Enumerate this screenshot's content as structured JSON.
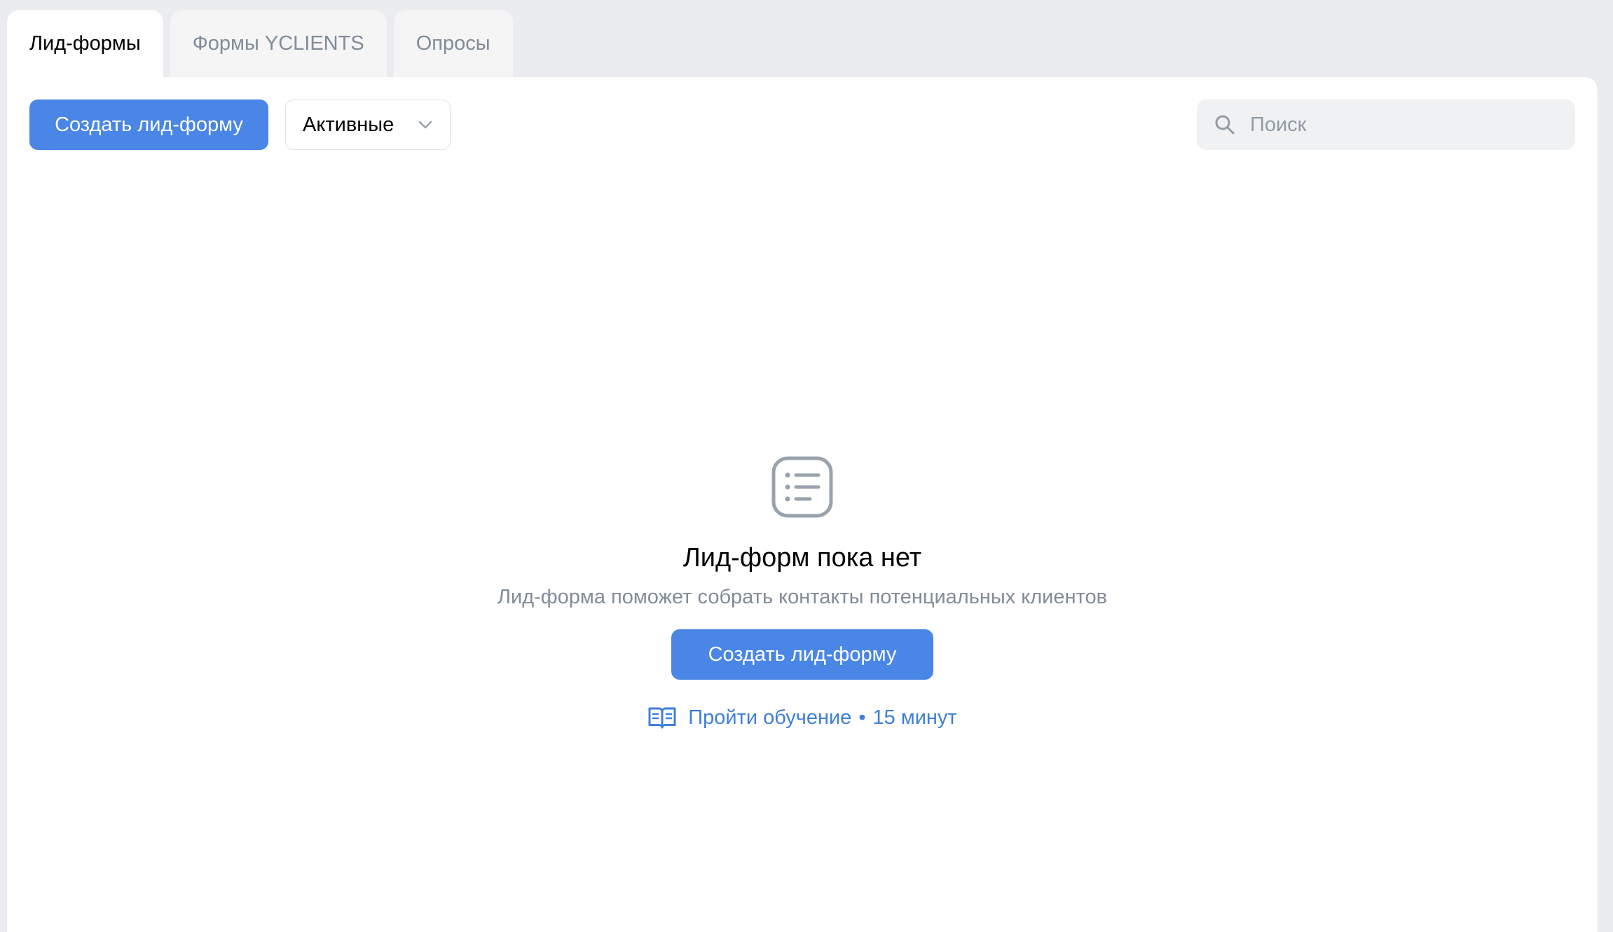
{
  "tabs": [
    {
      "label": "Лид-формы",
      "active": true
    },
    {
      "label": "Формы YCLIENTS",
      "active": false
    },
    {
      "label": "Опросы",
      "active": false
    }
  ],
  "toolbar": {
    "create_label": "Создать лид-форму",
    "filter_value": "Активные",
    "search_placeholder": "Поиск"
  },
  "empty_state": {
    "icon": "list-icon",
    "title": "Лид-форм пока нет",
    "subtitle": "Лид-форма поможет собрать контакты потенциальных клиентов",
    "button_label": "Создать лид-форму",
    "learn_label": "Пройти обучение",
    "learn_separator": "•",
    "learn_duration": "15 минут"
  },
  "colors": {
    "accent": "#4986e6",
    "link": "#3f7fd9",
    "muted_text": "#818c99",
    "background": "#ebecef"
  }
}
